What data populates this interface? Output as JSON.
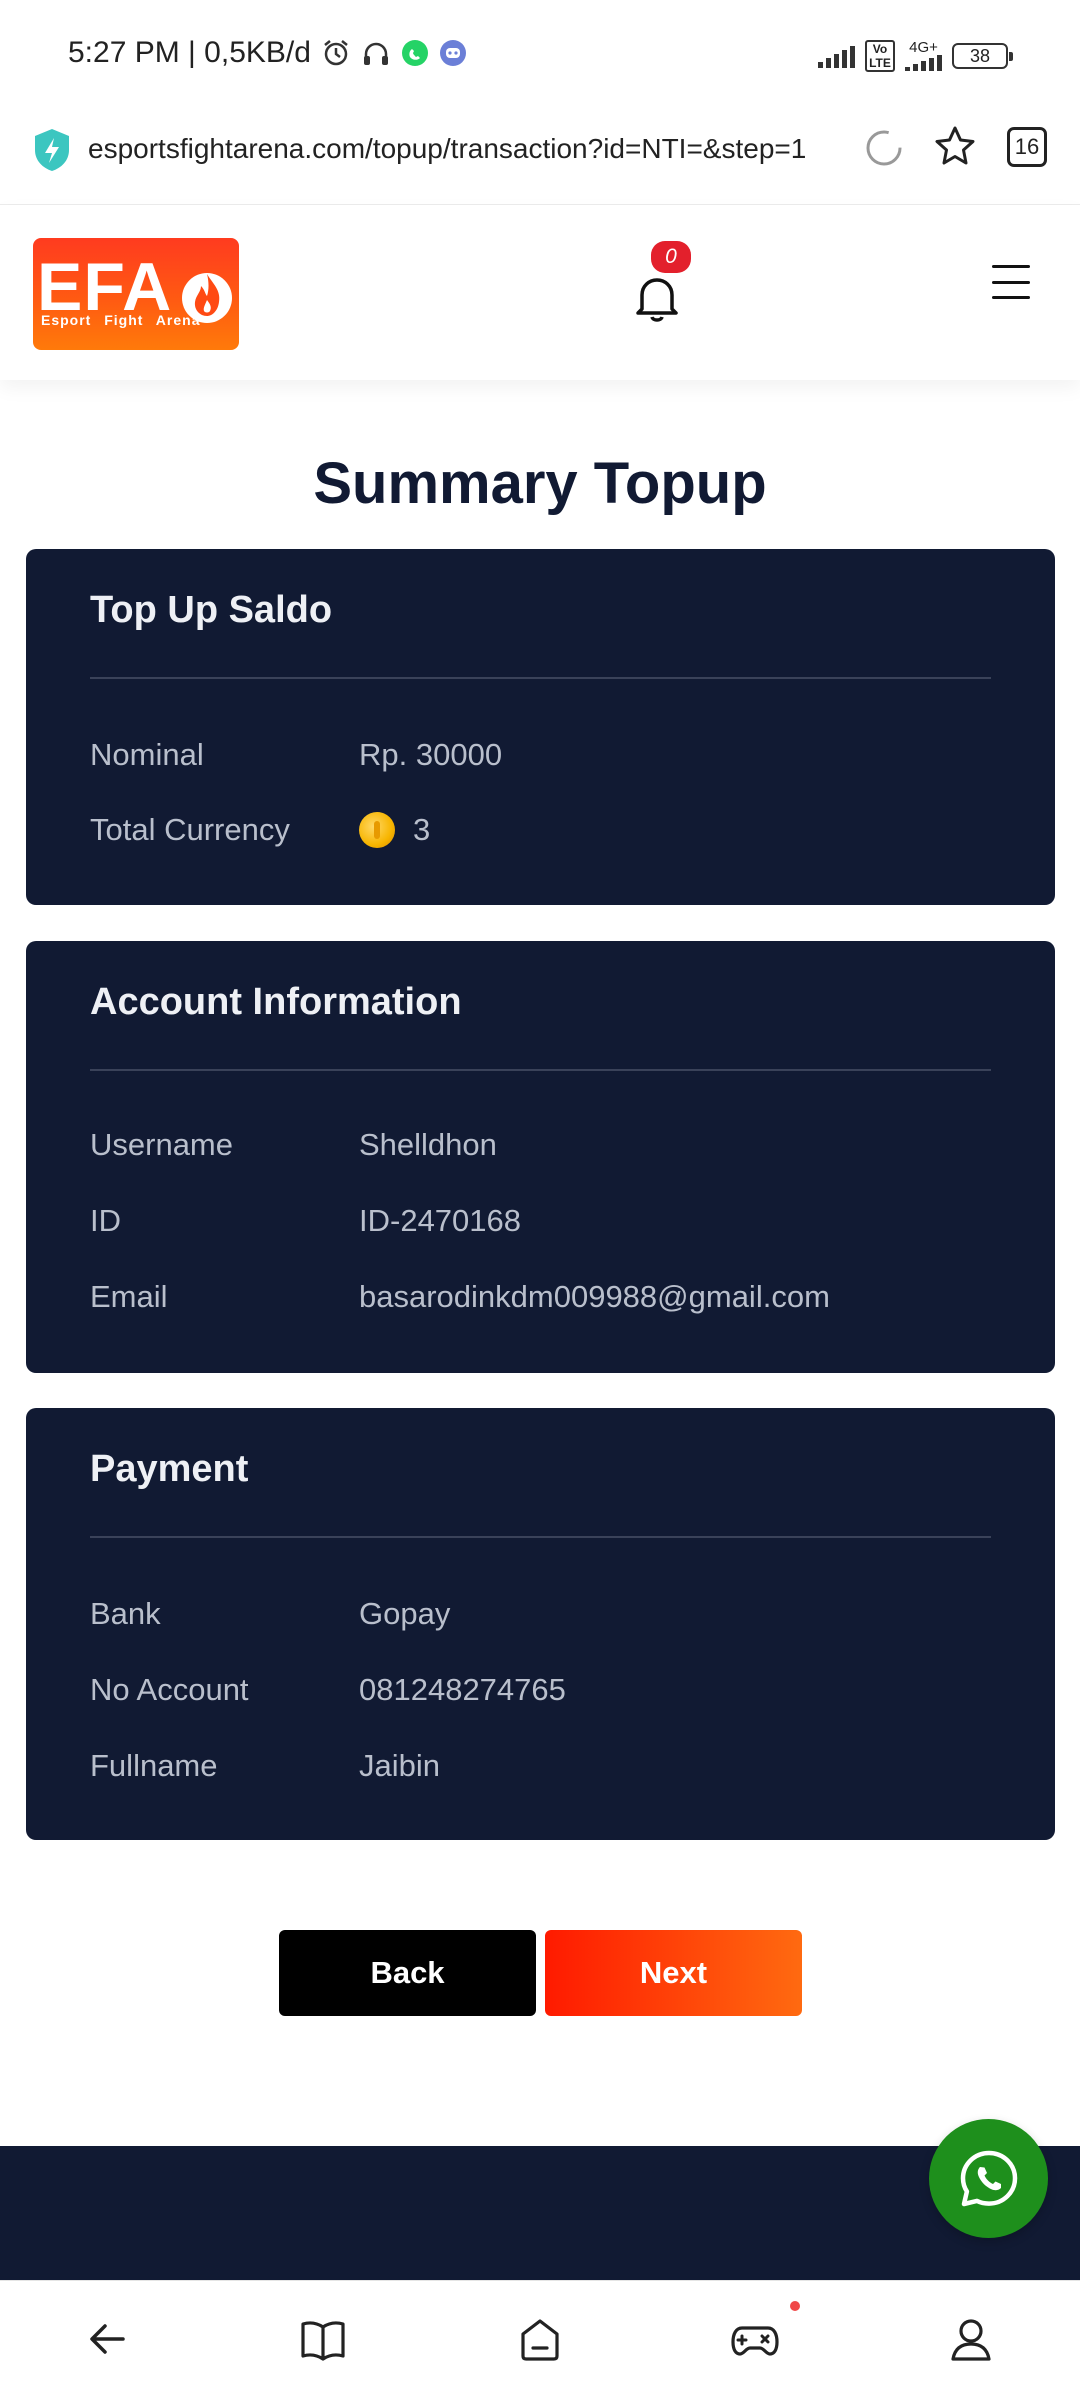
{
  "status_bar": {
    "time_text": "5:27 PM | 0,5KB/d",
    "network": "4G+",
    "lte": "Vo LTE",
    "battery": "38"
  },
  "browser": {
    "url": "esportsfightarena.com/topup/transaction?id=NTI=&step=1",
    "tab_count": "16"
  },
  "header": {
    "logo_text": "EFA",
    "logo_subtitle": "Esport Fight Arena",
    "notification_count": "0"
  },
  "page": {
    "title": "Summary Topup"
  },
  "topup_card": {
    "title": "Top Up Saldo",
    "rows": [
      {
        "label": "Nominal",
        "value": "Rp. 30000"
      },
      {
        "label": "Total Currency",
        "value": "3"
      }
    ]
  },
  "account_card": {
    "title": "Account Information",
    "rows": [
      {
        "label": "Username",
        "value": "Shelldhon"
      },
      {
        "label": "ID",
        "value": "ID-2470168"
      },
      {
        "label": "Email",
        "value": "basarodinkdm009988@gmail.com"
      }
    ]
  },
  "payment_card": {
    "title": "Payment",
    "rows": [
      {
        "label": "Bank",
        "value": "Gopay"
      },
      {
        "label": "No Account",
        "value": "081248274765"
      },
      {
        "label": "Fullname",
        "value": "Jaibin"
      }
    ]
  },
  "actions": {
    "back_label": "Back",
    "next_label": "Next"
  },
  "colors": {
    "card_bg": "#111a33",
    "accent": "#ff3b1f",
    "whatsapp": "#1e8f1c"
  },
  "icons": {
    "status": [
      "alarm-icon",
      "headphones-icon",
      "whatsapp-icon",
      "discord-icon"
    ],
    "nav": [
      "back-arrow-icon",
      "book-icon",
      "home-icon",
      "game-controller-icon",
      "profile-icon"
    ]
  }
}
